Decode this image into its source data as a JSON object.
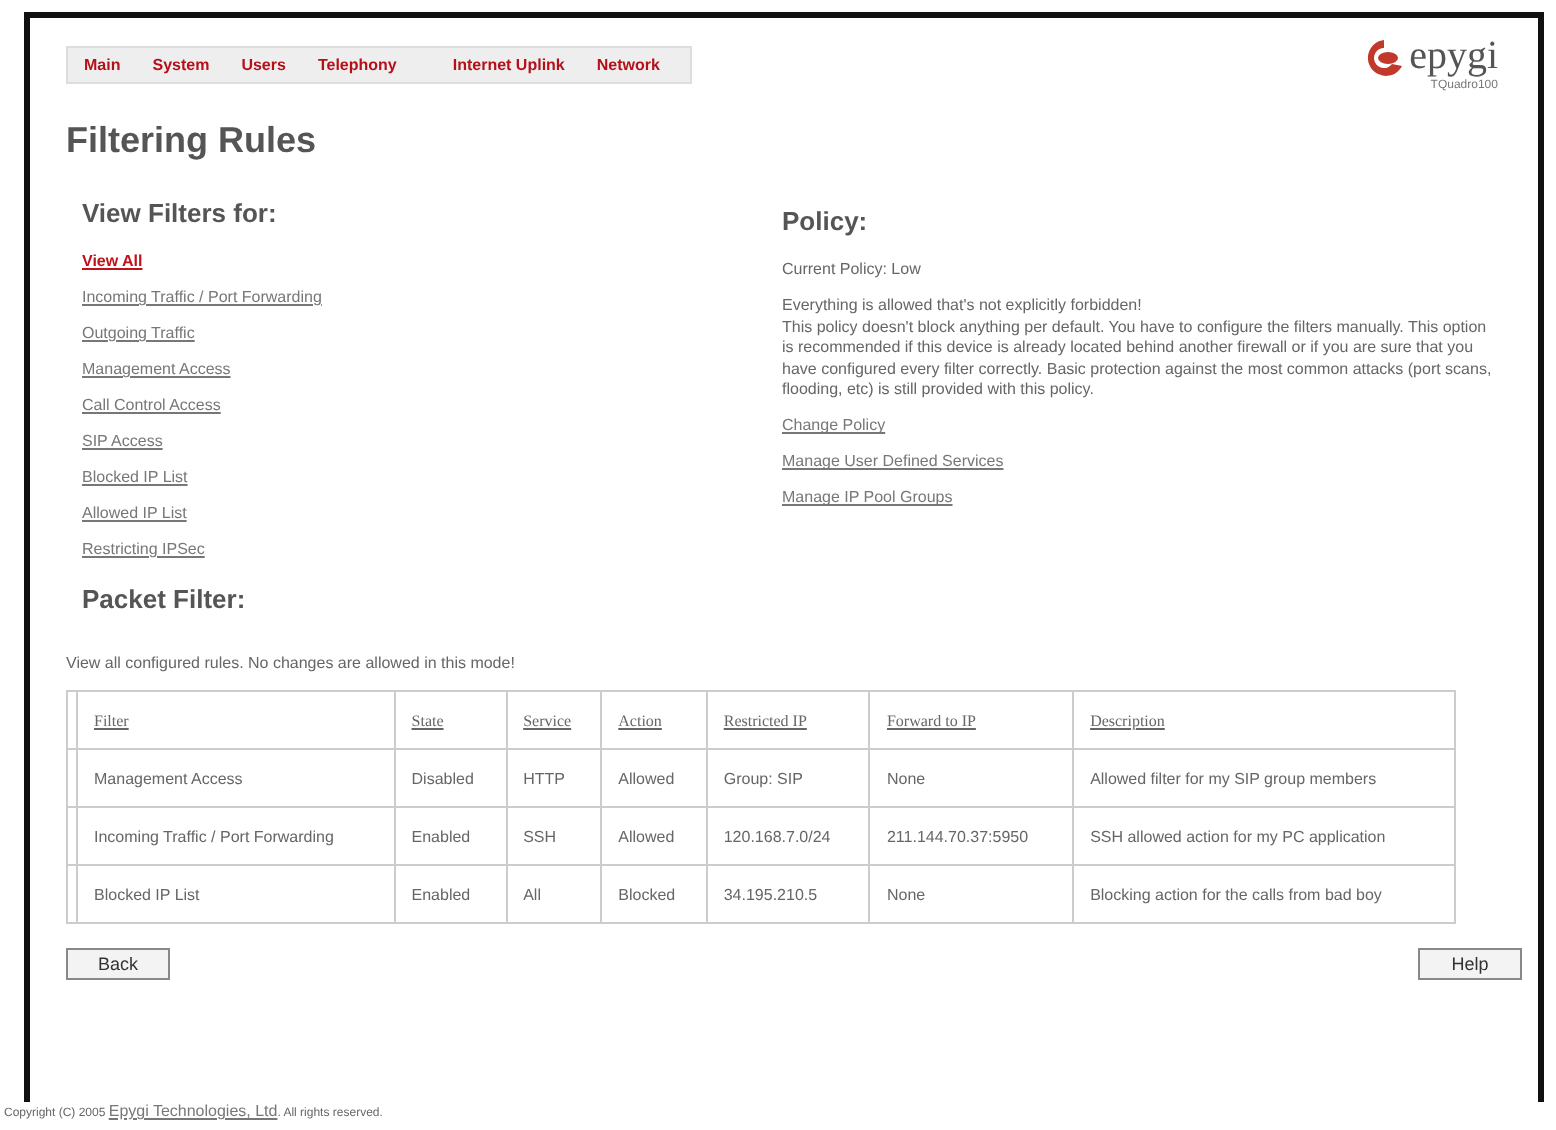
{
  "nav": [
    "Main",
    "System",
    "Users",
    "Telephony",
    "Internet Uplink",
    "Network"
  ],
  "logo": {
    "brand": "epygi",
    "model": "TQuadro100"
  },
  "title": "Filtering Rules",
  "view_filters": {
    "heading": "View Filters for:",
    "items": [
      {
        "label": "View All",
        "selected": true
      },
      {
        "label": "Incoming Traffic / Port Forwarding",
        "selected": false
      },
      {
        "label": "Outgoing Traffic",
        "selected": false
      },
      {
        "label": "Management Access",
        "selected": false
      },
      {
        "label": "Call Control Access",
        "selected": false
      },
      {
        "label": "SIP Access",
        "selected": false
      },
      {
        "label": "Blocked IP List",
        "selected": false
      },
      {
        "label": "Allowed IP List",
        "selected": false
      },
      {
        "label": "Restricting IPSec",
        "selected": false
      }
    ]
  },
  "policy": {
    "heading": "Policy:",
    "current": "Current Policy: Low",
    "description_lines": [
      "Everything is allowed that's not explicitly forbidden!",
      "This policy doesn't block anything per default. You have to configure the filters manually. This option is recommended if this device is already located behind another firewall or if you are sure that you have configured every filter correctly. Basic protection against the most common attacks (port scans, flooding, etc) is still provided with this policy."
    ],
    "links": [
      "Change Policy",
      "Manage User Defined Services",
      "Manage IP Pool Groups"
    ]
  },
  "packet_filter": {
    "heading": "Packet Filter:",
    "note": "View all configured rules. No changes are allowed in this mode!",
    "table": {
      "columns": [
        "Filter",
        "State",
        "Service",
        "Action",
        "Restricted IP",
        "Forward to IP",
        "Description"
      ],
      "rows": [
        [
          "Management Access",
          "Disabled",
          "HTTP",
          "Allowed",
          "Group: SIP",
          "None",
          "Allowed filter for my SIP group members"
        ],
        [
          "Incoming Traffic / Port Forwarding",
          "Enabled",
          "SSH",
          "Allowed",
          "120.168.7.0/24",
          "211.144.70.37:5950",
          "SSH allowed action for my PC application"
        ],
        [
          "Blocked IP List",
          "Enabled",
          "All",
          "Blocked",
          "34.195.210.5",
          "None",
          "Blocking action for the calls from bad boy"
        ]
      ]
    }
  },
  "buttons": {
    "back": "Back",
    "help": "Help"
  },
  "footer": {
    "before": "Copyright (C) 2005 ",
    "link": "Epygi Technologies, Ltd",
    "after": ". All rights reserved."
  }
}
